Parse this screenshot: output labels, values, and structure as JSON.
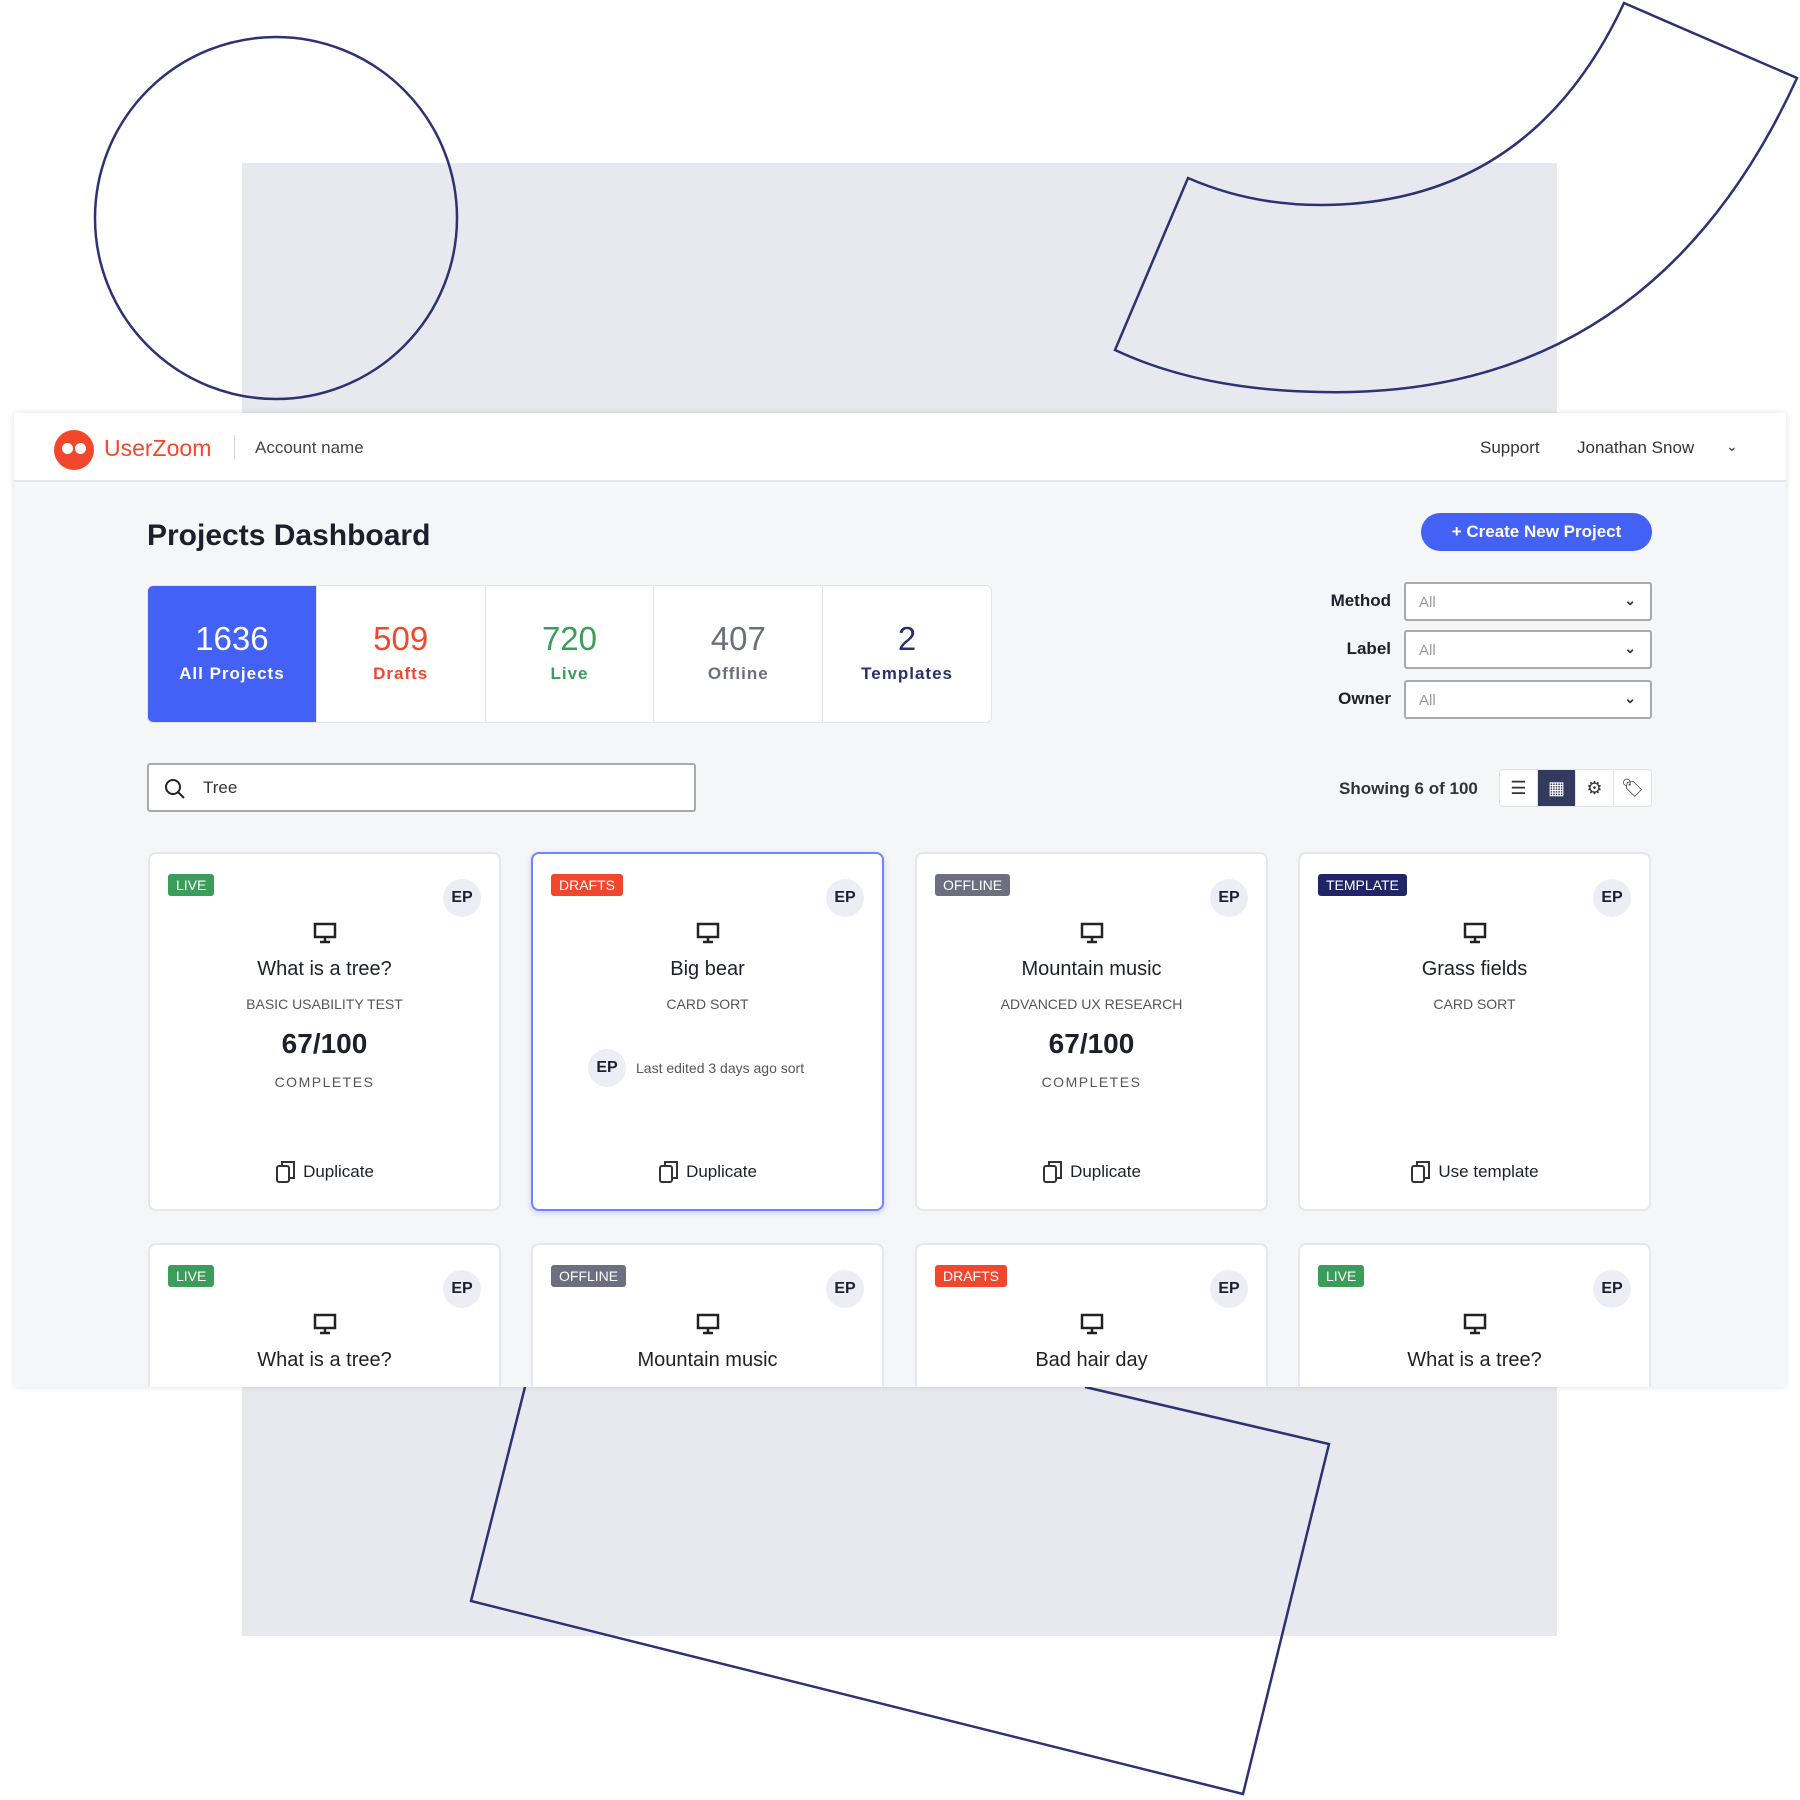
{
  "header": {
    "brand": "UserZoom",
    "account": "Account name",
    "support": "Support",
    "user": "Jonathan Snow"
  },
  "page": {
    "title": "Projects Dashboard",
    "create_label": "Create New Project"
  },
  "stats": [
    {
      "value": "1636",
      "label": "All Projects",
      "color": "#ffffff",
      "active": true
    },
    {
      "value": "509",
      "label": "Drafts",
      "color": "#f2472c"
    },
    {
      "value": "720",
      "label": "Live",
      "color": "#3a9d5a"
    },
    {
      "value": "407",
      "label": "Offline",
      "color": "#6b6f80"
    },
    {
      "value": "2",
      "label": "Templates",
      "color": "#2b2f6b"
    }
  ],
  "filters": [
    {
      "label": "Method",
      "value": "All"
    },
    {
      "label": "Label",
      "value": "All"
    },
    {
      "label": "Owner",
      "value": "All"
    }
  ],
  "search": {
    "value": "Tree"
  },
  "showing": "Showing 6 of 100",
  "views": [
    "list-icon",
    "grid-icon",
    "gear-icon",
    "tag-icon"
  ],
  "cards": [
    {
      "status": "LIVE",
      "status_color": "#3a9d5a",
      "owner": "EP",
      "title": "What is a tree?",
      "method": "BASIC USABILITY TEST",
      "count": "67/100",
      "count_label": "COMPLETES",
      "action": "Duplicate"
    },
    {
      "status": "DRAFTS",
      "status_color": "#f2472c",
      "owner": "EP",
      "title": "Big bear",
      "method": "CARD SORT",
      "edited": "Last edited 3 days ago sort",
      "action": "Duplicate"
    },
    {
      "status": "OFFLINE",
      "status_color": "#6b6f80",
      "owner": "EP",
      "title": "Mountain music",
      "method": "ADVANCED UX RESEARCH",
      "count": "67/100",
      "count_label": "COMPLETES",
      "action": "Duplicate"
    },
    {
      "status": "TEMPLATE",
      "status_color": "#1f2566",
      "owner": "EP",
      "title": "Grass fields",
      "method": "CARD SORT",
      "action": "Use template"
    },
    {
      "status": "LIVE",
      "status_color": "#3a9d5a",
      "owner": "EP",
      "title": "What is a tree?"
    },
    {
      "status": "OFFLINE",
      "status_color": "#6b6f80",
      "owner": "EP",
      "title": "Mountain music"
    },
    {
      "status": "DRAFTS",
      "status_color": "#f2472c",
      "owner": "EP",
      "title": "Bad hair day"
    },
    {
      "status": "LIVE",
      "status_color": "#3a9d5a",
      "owner": "EP",
      "title": "What is a tree?"
    }
  ]
}
